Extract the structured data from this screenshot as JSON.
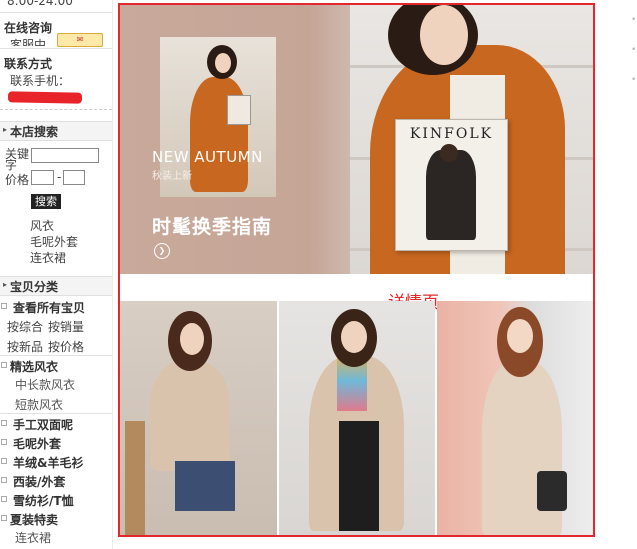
{
  "sidebar": {
    "hours": "8:00-24:00",
    "online_consult": "在线咨询",
    "service_label": "客服中",
    "contact_heading": "联系方式",
    "phone_label": "联系手机：",
    "store_search": "本店搜索",
    "keyword_label": "关键字",
    "price_label": "价格",
    "price_sep": "-",
    "search_button": "搜索",
    "quick_links": [
      "风衣",
      "毛呢外套",
      "连衣裙"
    ],
    "category_header": "宝贝分类",
    "view_all": "查看所有宝贝",
    "sort_links": [
      "按综合",
      "按销量",
      "按新品",
      "按价格"
    ],
    "categories": [
      {
        "label": "精选风衣",
        "children": [
          "中长款风衣",
          "短款风衣"
        ]
      },
      {
        "label": "手工双面呢",
        "children": []
      },
      {
        "label": "毛呢外套",
        "children": []
      },
      {
        "label": "羊绒&羊毛衫",
        "children": []
      },
      {
        "label": "西装/外套",
        "children": []
      },
      {
        "label": "雪纺衫/T恤",
        "children": []
      },
      {
        "label": "夏装特卖",
        "children": [
          "连衣裙"
        ]
      }
    ]
  },
  "banner": {
    "headline_en": "NEW AUTUMN",
    "headline_cn_small": "秋装上新",
    "headline_main": "时髦换季指南",
    "magazine_title": "KINFOLK"
  },
  "annotation": "详情页",
  "colors": {
    "highlight_border": "#e3282d",
    "coat_orange": "#c8671f",
    "coat_beige": "#d9c3ad"
  }
}
